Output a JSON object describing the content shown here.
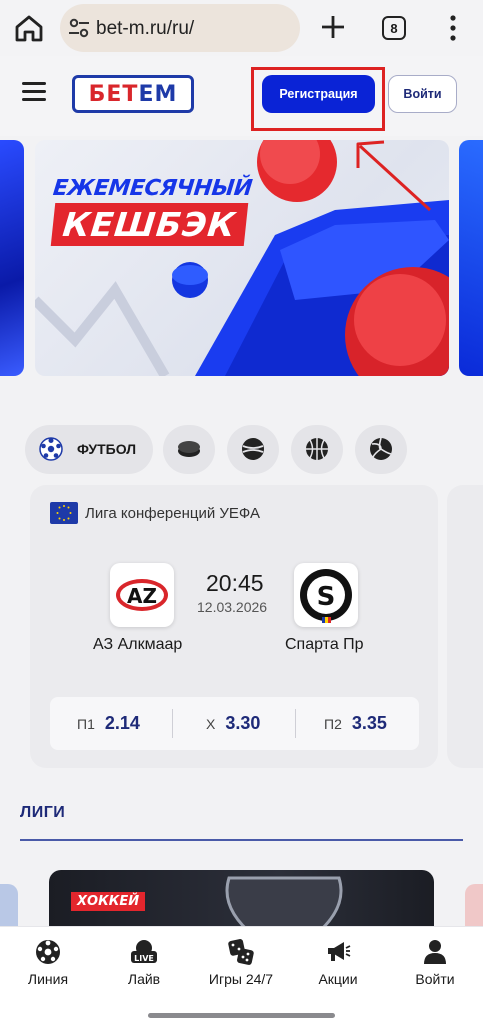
{
  "browser": {
    "url": "bet-m.ru/ru/",
    "tab_count": "8"
  },
  "header": {
    "logo_part1": "БЕТ",
    "logo_part2": "ЕМ",
    "register_label": "Регистрация",
    "login_label": "Войти"
  },
  "banner": {
    "line1": "ЕЖЕМЕСЯЧНЫЙ",
    "line2": "КЕШБЭК"
  },
  "sports": {
    "active_label": "ФУТБОЛ",
    "icons": [
      "football-icon",
      "hockey-puck-icon",
      "tennis-ball-icon",
      "basketball-icon",
      "volleyball-icon"
    ]
  },
  "match": {
    "league": "Лига конференций УЕФА",
    "home_team": "АЗ Алкмаар",
    "away_team": "Спарта Пр",
    "time": "20:45",
    "date": "12.03.2026",
    "odds": [
      {
        "label": "П1",
        "value": "2.14"
      },
      {
        "label": "Х",
        "value": "3.30"
      },
      {
        "label": "П2",
        "value": "3.35"
      }
    ]
  },
  "leagues": {
    "title": "ЛИГИ",
    "card_tag": "ХОККЕЙ"
  },
  "bottom_nav": [
    {
      "label": "Линия",
      "icon": "football-icon"
    },
    {
      "label": "Лайв",
      "icon": "live-icon"
    },
    {
      "label": "Игры 24/7",
      "icon": "dice-icon"
    },
    {
      "label": "Акции",
      "icon": "megaphone-icon"
    },
    {
      "label": "Войти",
      "icon": "user-icon"
    }
  ],
  "colors": {
    "brand_blue": "#0a23d6",
    "brand_red": "#e3262d",
    "odds_text": "#1e2a78",
    "annotation_red": "#d22"
  }
}
